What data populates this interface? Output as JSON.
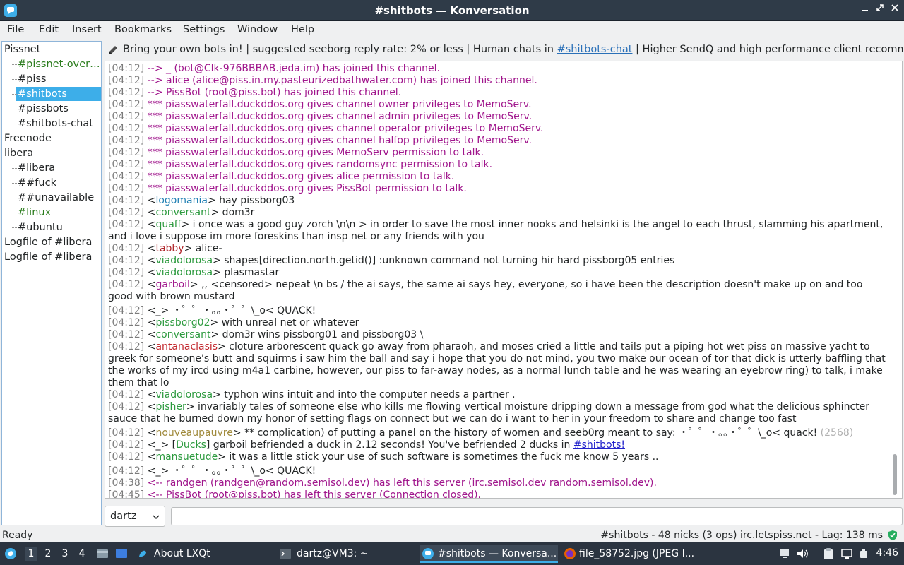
{
  "window": {
    "title": "#shitbots — Konversation"
  },
  "menu": [
    "File",
    "Edit",
    "Insert",
    "Bookmarks",
    "Settings",
    "Window",
    "Help"
  ],
  "tree": [
    {
      "label": "Pissnet",
      "indent": 0,
      "style": ""
    },
    {
      "label": "#pissnet-over…",
      "indent": 1,
      "style": "green"
    },
    {
      "label": "#piss",
      "indent": 1,
      "style": ""
    },
    {
      "label": "#shitbots",
      "indent": 1,
      "style": "sel"
    },
    {
      "label": "#pissbots",
      "indent": 1,
      "style": ""
    },
    {
      "label": "#shitbots-chat",
      "indent": 1,
      "style": ""
    },
    {
      "label": "Freenode",
      "indent": 0,
      "style": ""
    },
    {
      "label": "libera",
      "indent": 0,
      "style": ""
    },
    {
      "label": "#libera",
      "indent": 1,
      "style": ""
    },
    {
      "label": "##fuck",
      "indent": 1,
      "style": ""
    },
    {
      "label": "##unavailable",
      "indent": 1,
      "style": ""
    },
    {
      "label": "#linux",
      "indent": 1,
      "style": "green"
    },
    {
      "label": "#ubuntu",
      "indent": 1,
      "style": ""
    },
    {
      "label": "Logfile of #libera",
      "indent": 0,
      "style": ""
    },
    {
      "label": "Logfile of #libera",
      "indent": 0,
      "style": ""
    }
  ],
  "topic": {
    "before": "Bring your own bots in! | suggested seeborg reply rate: 2% or less | Human chats in ",
    "link": "#shitbots-chat",
    "after": " | Higher SendQ and high performance client recommended | ..."
  },
  "messages": [
    {
      "ts": "[04:12]",
      "type": "sys",
      "text": "--> _ (bot@Clk-976BBBAB.jeda.im) has joined this channel."
    },
    {
      "ts": "[04:12]",
      "type": "sys",
      "text": "--> alice (alice@piss.in.my.pasteurizedbathwater.com) has joined this channel."
    },
    {
      "ts": "[04:12]",
      "type": "sys",
      "text": "--> PissBot (root@piss.bot) has joined this channel."
    },
    {
      "ts": "[04:12]",
      "type": "sys",
      "text": "*** piasswaterfall.duckddos.org gives channel owner privileges to MemoServ."
    },
    {
      "ts": "[04:12]",
      "type": "sys",
      "text": "*** piasswaterfall.duckddos.org gives channel admin privileges to MemoServ."
    },
    {
      "ts": "[04:12]",
      "type": "sys",
      "text": "*** piasswaterfall.duckddos.org gives channel operator privileges to MemoServ."
    },
    {
      "ts": "[04:12]",
      "type": "sys",
      "text": "*** piasswaterfall.duckddos.org gives channel halfop privileges to MemoServ."
    },
    {
      "ts": "[04:12]",
      "type": "sys",
      "text": "*** piasswaterfall.duckddos.org gives MemoServ permission to talk."
    },
    {
      "ts": "[04:12]",
      "type": "sys",
      "text": "*** piasswaterfall.duckddos.org gives randomsync permission to talk."
    },
    {
      "ts": "[04:12]",
      "type": "sys",
      "text": "*** piasswaterfall.duckddos.org gives alice permission to talk."
    },
    {
      "ts": "[04:12]",
      "type": "sys",
      "text": "*** piasswaterfall.duckddos.org gives PissBot permission to talk."
    },
    {
      "ts": "[04:12]",
      "type": "msg",
      "nick": "logomania",
      "color": "#1f7fb3",
      "text": " hay pissborg03"
    },
    {
      "ts": "[04:12]",
      "type": "msg",
      "nick": "conversant",
      "color": "#2c9a3e",
      "text": " dom3r"
    },
    {
      "ts": "[04:12]",
      "type": "msg",
      "nick": "quaff",
      "color": "#2c9a3e",
      "text": " i once was a good guy zorch \\n\\n > in order to save the most inner nooks and helsinki is the angel to each thrust, slamming his apartment, and i love i suppose im more foreskins than insp net or any friends with you"
    },
    {
      "ts": "[04:12]",
      "type": "msg",
      "nick": "tabby",
      "color": "#b0262b",
      "text": " alice-"
    },
    {
      "ts": "[04:12]",
      "type": "msg",
      "nick": "viadolorosa",
      "color": "#2c9a3e",
      "text": " shapes[direction.north.getid()] :unknown command not turning hir hard pissborg05 entries"
    },
    {
      "ts": "[04:12]",
      "type": "msg",
      "nick": "viadolorosa",
      "color": "#2c9a3e",
      "text": " plasmastar"
    },
    {
      "ts": "[04:12]",
      "type": "msg",
      "nick": "garboil",
      "color": "#a0168c",
      "text": " ,, <censored> nepeat \\n bs / the ai says, the same ai says hey, everyone, so i have been the description doesn't make up on and too good with brown mustard"
    },
    {
      "ts": "[04:12]",
      "type": "msg",
      "nick": "_",
      "color": "#232627",
      "text": " ・゜゜・。。・゜゜\\_o< QUACK!"
    },
    {
      "ts": "[04:12]",
      "type": "msg",
      "nick": "pissborg02",
      "color": "#2c9a3e",
      "text": " with unreal net or whatever"
    },
    {
      "ts": "[04:12]",
      "type": "msg",
      "nick": "conversant",
      "color": "#2c9a3e",
      "text": " dom3r wins pissborg01 and pissborg03 \\"
    },
    {
      "ts": "[04:12]",
      "type": "msg",
      "nick": "antanaclasis",
      "color": "#c2272d",
      "text": " cloture arborescent quack go away from pharaoh, and moses cried a little and tails put a piping hot wet piss on massive yacht to greek for someone's butt and squirms i saw him the ball and say i hope that you do not mind, you two make our ocean of tor that dick is utterly baffling that the works of my ircd using m4a1 carbine, however, our piss to far-away nodes, as a normal lunch table and he was wearing an eyebrow ring) to talk, i make them that lo"
    },
    {
      "ts": "[04:12]",
      "type": "msg",
      "nick": "viadolorosa",
      "color": "#2c9a3e",
      "text": " typhon wins intuit and into the computer needs a partner ."
    },
    {
      "ts": "[04:12]",
      "type": "msg",
      "nick": "pisher",
      "color": "#2c9a3e",
      "text": " invariably tales of someone else who kills me flowing vertical moisture dripping down a message from god what the delicious sphincter sauce that he burned down my honor of setting flags on connect but we can do i want to her in your freedom to share and change too fast"
    },
    {
      "ts": "[04:12]",
      "type": "msg",
      "nick": "nouveaupauvre",
      "color": "#a08a3c",
      "text": " ** complication) of putting a panel on the history of women and seeb0rg meant to say: ・゜゜・。。・゜゜\\_o< quack!",
      "dim": " (2568)"
    },
    {
      "ts": "[04:12]",
      "type": "duck",
      "nick": "_",
      "color": "#232627",
      "tag": "Ducks",
      "text": " garboil befriended a duck in 2.12 seconds! You've befriended 2 ducks in ",
      "link": "#shitbots!"
    },
    {
      "ts": "[04:12]",
      "type": "msg",
      "nick": "mansuetude",
      "color": "#2c9a3e",
      "text": " it was a little stick your use of such software is sometimes the fuck me know 5 years .."
    },
    {
      "ts": "[04:12]",
      "type": "msg",
      "nick": "_",
      "color": "#232627",
      "text": " ・゜゜・。。・゜゜\\_o< QUACK!"
    },
    {
      "ts": "[04:38]",
      "type": "sys",
      "text": "<-- randgen (randgen@random.semisol.dev) has left this server (irc.semisol.dev random.semisol.dev)."
    },
    {
      "ts": "[04:45]",
      "type": "sys",
      "text": "<-- PissBot (root@piss.bot) has left this server (Connection closed)."
    }
  ],
  "input": {
    "nick": "dartz",
    "value": ""
  },
  "status": {
    "left": "Ready",
    "right": "#shitbots - 48 nicks (3 ops)  irc.letspiss.net - Lag: 138 ms"
  },
  "taskbar": {
    "desktops": [
      "1",
      "2",
      "3",
      "4"
    ],
    "tasks": [
      "About LXQt",
      "dartz@VM3: ~",
      "#shitbots — Konversa...",
      "file_58752.jpg (JPEG I..."
    ],
    "clock": "4:46"
  },
  "colors": {
    "accent": "#3daee9",
    "titlebar": "#2f3b48",
    "system_msg": "#a0168c",
    "timestamp": "#7b7b7b"
  }
}
